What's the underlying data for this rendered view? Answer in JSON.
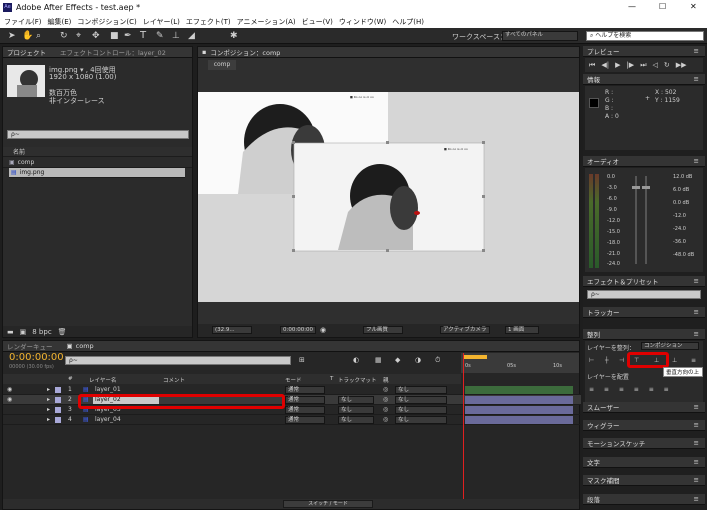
{
  "app": {
    "title": "Adobe After Effects - test.aep *",
    "logo": "Ae"
  },
  "window": {
    "minimize": "—",
    "maximize": "☐",
    "close": "✕"
  },
  "menu": [
    "ファイル(F)",
    "編集(E)",
    "コンポジション(C)",
    "レイヤー(L)",
    "エフェクト(T)",
    "アニメーション(A)",
    "ビュー(V)",
    "ウィンドウ(W)",
    "ヘルプ(H)"
  ],
  "toolbar": {
    "workspace_label": "ワークスペース：",
    "workspace_value": "すべてのパネル",
    "help_placeholder": "ヘルプを検索"
  },
  "project": {
    "tab": "プロジェクト",
    "effects_tab": "エフェクトコントロール：layer_02",
    "file_name": "img.png ▾ , 4回使用",
    "dims": "1920 x 1080 (1.00)",
    "color": "数百万色",
    "interlace": "非インターレース",
    "search": "ρ~",
    "col_name": "名前",
    "items": [
      "comp",
      "img.png"
    ],
    "bpc": "8 bpc"
  },
  "comp": {
    "tab": "コンポジション：comp",
    "subtab": "comp",
    "zoom": "(32.9...",
    "timecode": "0:00:00:00",
    "quality": "フル画質",
    "camera": "アクティブカメラ",
    "views": "1 画面",
    "caption1": "■ Ro oo is ol oo",
    "caption2": "■ Ro oo is ol oo"
  },
  "timeline": {
    "render_tab": "レンダーキュー",
    "comp_tab": "comp",
    "timecode": "0:00:00:00",
    "timecode_sub": "00000 (30.00 fps)",
    "search": "ρ~",
    "cols": {
      "num": "#",
      "name": "レイヤー名",
      "comment": "コメント",
      "mode": "モード",
      "t": "T",
      "trackmatte": "トラックマット",
      "parent": "親"
    },
    "ruler": [
      "0s",
      "05s",
      "10s"
    ],
    "layers": [
      {
        "num": "1",
        "name": "layer_01",
        "mode": "通常",
        "track": "",
        "parent": "なし"
      },
      {
        "num": "2",
        "name": "layer_02",
        "mode": "通常",
        "track": "なし",
        "parent": "なし"
      },
      {
        "num": "3",
        "name": "layer_03",
        "mode": "通常",
        "track": "なし",
        "parent": "なし"
      },
      {
        "num": "4",
        "name": "layer_04",
        "mode": "通常",
        "track": "なし",
        "parent": "なし"
      }
    ],
    "footer": "スイッチ / モード"
  },
  "right": {
    "help": "ヘルプを検索",
    "preview": "プレビュー",
    "info": "情報",
    "r": "R :",
    "g": "G :",
    "b": "B :",
    "a": "A : 0",
    "x": "X : 502",
    "y": "Y : 1159",
    "audio": "オーディオ",
    "audio_left": [
      "0.0",
      "-3.0",
      "-6.0",
      "-9.0",
      "-12.0",
      "-15.0",
      "-18.0",
      "-21.0",
      "-24.0"
    ],
    "audio_right": [
      "12.0 dB",
      "6.0 dB",
      "0.0 dB",
      "-12.0",
      "-24.0",
      "-36.0",
      "-48.0 dB"
    ],
    "effects": "エフェクト＆プリセット",
    "search": "ρ~",
    "tracker": "トラッカー",
    "align": "整列",
    "align_to_label": "レイヤーを整列：",
    "align_to_value": "コンポジション",
    "distribute": "レイヤーを配置",
    "tooltip": "垂直方向の上",
    "smoother": "スムーザー",
    "wiggler": "ウィグラー",
    "motion_sketch": "モーションスケッチ",
    "paragraph": "文字",
    "mask": "マスク補間",
    "paint": "段落"
  }
}
